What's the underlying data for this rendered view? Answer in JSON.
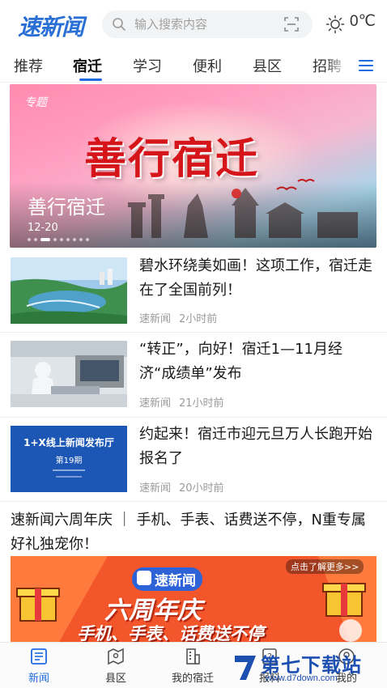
{
  "header": {
    "logo": "速新闻",
    "search_placeholder": "输入搜索内容",
    "temperature": "0℃",
    "icons": {
      "search": "search-icon",
      "scan": "scan-icon",
      "weather": "sun-icon"
    }
  },
  "tabs": {
    "items": [
      "推荐",
      "宿迁",
      "学习",
      "便利",
      "县区",
      "招聘"
    ],
    "active": "宿迁",
    "menu_icon": "menu-icon"
  },
  "banner": {
    "tag": "专题",
    "art_text": "善行宿迁",
    "title": "善行宿迁",
    "date": "12-20"
  },
  "news": [
    {
      "title": "碧水环绕美如画！这项工作，宿迁走在了全国前列！",
      "source": "速新闻",
      "time": "2小时前"
    },
    {
      "title": "“转正”，向好！宿迁1—11月经济“成绩单”发布",
      "source": "速新闻",
      "time": "21小时前"
    },
    {
      "title": "约起来！宿迁市迎元旦万人长跑开始报名了",
      "source": "速新闻",
      "time": "20小时前",
      "thumb": {
        "heading": "1+X线上新闻发布厅",
        "sub": "第19期"
      }
    }
  ],
  "promo": {
    "title": "速新闻六周年庆 ｜ 手机、手表、话费送不停，N重专属好礼独宠你！",
    "brand": "速新闻",
    "main": "六周年庆",
    "sub": "手机、手表、话费送不停",
    "hint": "点击了解更多>>"
  },
  "bottom_nav": {
    "items": [
      {
        "label": "新闻",
        "icon": "news-icon"
      },
      {
        "label": "县区",
        "icon": "map-icon"
      },
      {
        "label": "我的宿迁",
        "icon": "building-icon"
      },
      {
        "label": "报料",
        "icon": "report-icon"
      },
      {
        "label": "我的",
        "icon": "user-icon"
      }
    ],
    "active": "新闻"
  },
  "watermark": {
    "text": "第七下载站",
    "url": "www.d7down.com"
  },
  "colors": {
    "accent": "#1f6be0",
    "banner_title": "#d6151b",
    "promo": "#f4562b"
  }
}
